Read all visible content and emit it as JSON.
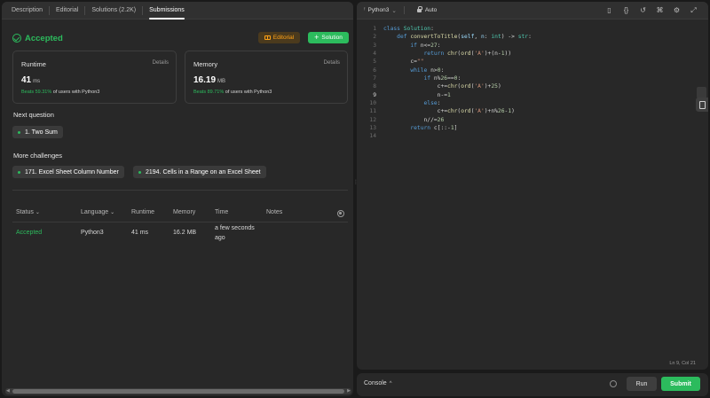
{
  "left_tabs": [
    "Description",
    "Editorial",
    "Solutions (2.2K)",
    "Submissions"
  ],
  "result": {
    "status": "Accepted",
    "editorial_label": "Editorial",
    "solution_label": "Solution"
  },
  "runtime": {
    "title": "Runtime",
    "details": "Details",
    "value": "41",
    "unit": "ms",
    "beats_pct": "Beats 59.31%",
    "beats_rest": "of users with Python3"
  },
  "memory": {
    "title": "Memory",
    "details": "Details",
    "value": "16.19",
    "unit": "MB",
    "beats_pct": "Beats 89.71%",
    "beats_rest": "of users with Python3"
  },
  "next_question": {
    "label": "Next question",
    "item": "1. Two Sum"
  },
  "more_challenges": {
    "label": "More challenges",
    "items": [
      "171. Excel Sheet Column Number",
      "2194. Cells in a Range on an Excel Sheet"
    ]
  },
  "table": {
    "headers": [
      "Status",
      "Language",
      "Runtime",
      "Memory",
      "Time",
      "Notes"
    ],
    "rows": [
      {
        "status": "Accepted",
        "language": "Python3",
        "runtime": "41 ms",
        "memory": "16.2 MB",
        "time_line1": "a few seconds",
        "time_line2": "ago",
        "notes": ""
      }
    ]
  },
  "editor": {
    "language": "Python3",
    "mode": "Auto",
    "cursor_position": "Ln 9, Col 21",
    "line_numbers": [
      "1",
      "2",
      "3",
      "4",
      "5",
      "6",
      "7",
      "8",
      "9",
      "10",
      "11",
      "12",
      "13",
      "14"
    ]
  },
  "console": {
    "label": "Console",
    "run_label": "Run",
    "submit_label": "Submit"
  },
  "colors": {
    "accent_green": "#2cbb5d",
    "editorial_orange": "#ffa116",
    "panel_bg": "#282828"
  }
}
